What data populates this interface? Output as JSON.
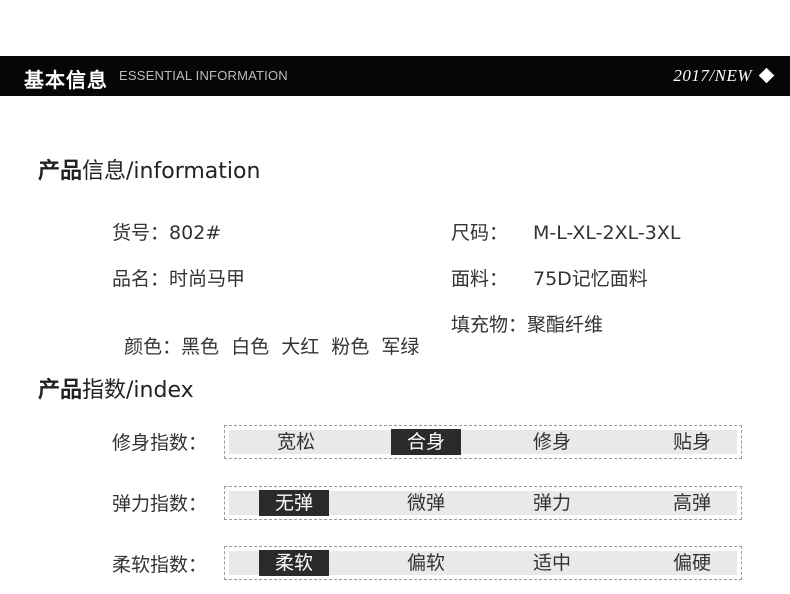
{
  "header": {
    "title_cn": "基本信息",
    "title_en": "ESSENTIAL INFORMATION",
    "tag": "2017/NEW"
  },
  "info_section": {
    "title_bold": "产品",
    "title_rest": "信息/information",
    "fields": [
      {
        "label": "货号：",
        "value": "802#"
      },
      {
        "label": "尺码：",
        "value": "M-L-XL-2XL-3XL"
      },
      {
        "label": "品名：",
        "value": "时尚马甲"
      },
      {
        "label": "面料：",
        "value": "75D记忆面料"
      },
      {
        "label": "颜色：",
        "value": "黑色  白色  大红  粉色  军绿"
      },
      {
        "label": "填充物：",
        "value": "聚酯纤维"
      }
    ]
  },
  "index_section": {
    "title_bold": "产品",
    "title_rest": "指数/index",
    "rows": [
      {
        "label": "修身指数：",
        "options": [
          "宽松",
          "合身",
          "修身",
          "贴身"
        ],
        "selected": 1
      },
      {
        "label": "弹力指数：",
        "options": [
          "无弹",
          "微弹",
          "弹力",
          "高弹"
        ],
        "selected": 0
      },
      {
        "label": "柔软指数：",
        "options": [
          "柔软",
          "偏软",
          "适中",
          "偏硬"
        ],
        "selected": 0
      }
    ]
  }
}
